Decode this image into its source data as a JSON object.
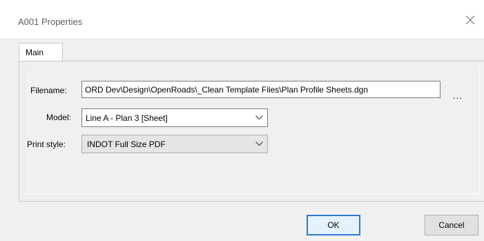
{
  "window": {
    "title": "A001 Properties",
    "close_label": "×"
  },
  "tabs": [
    {
      "label": "Main"
    }
  ],
  "form": {
    "filename_label": "Filename:",
    "filename_value": "ORD Dev\\Design\\OpenRoads\\_Clean Template Files\\Plan Profile Sheets.dgn",
    "browse_label": "...",
    "model_label": "Model:",
    "model_value": "Line A - Plan 3 [Sheet]",
    "print_style_label": "Print style:",
    "print_style_value": "INDOT Full Size PDF"
  },
  "buttons": {
    "ok_label": "OK",
    "cancel_label": "Cancel"
  },
  "colors": {
    "default_button_border": "#2b79d6",
    "title_text": "#5b5b5b"
  },
  "icons": {
    "close": "close-icon",
    "dropdown": "chevron-down-icon"
  }
}
